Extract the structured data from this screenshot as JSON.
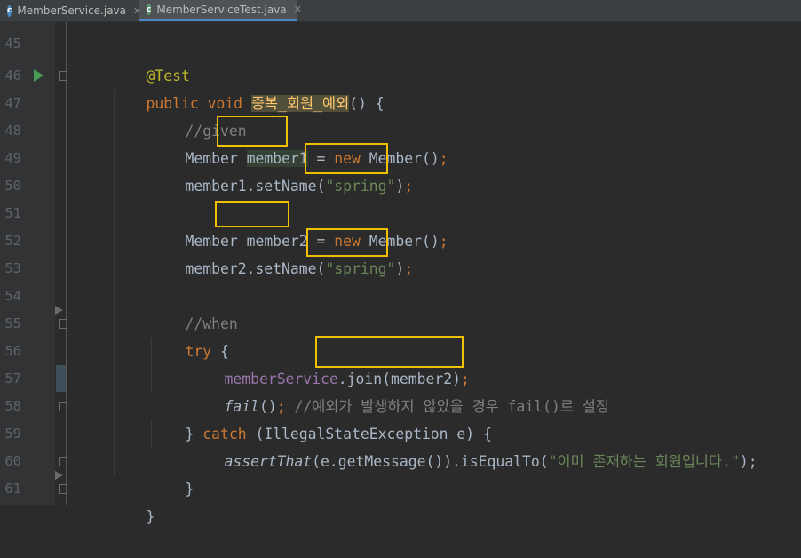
{
  "tabs": [
    {
      "label": "MemberService.java",
      "icon": "class-icon",
      "close": "✕"
    },
    {
      "label": "MemberServiceTest.java",
      "icon": "test-class-icon",
      "close": "✕"
    }
  ],
  "line_numbers": [
    "45",
    "46",
    "47",
    "48",
    "49",
    "50",
    "51",
    "52",
    "53",
    "54",
    "55",
    "56",
    "57",
    "58",
    "59",
    "60",
    "61"
  ],
  "code": {
    "l45": {
      "annotation": "@Test"
    },
    "l46": {
      "kw1": "public",
      "kw2": "void",
      "method": "중복_회원_예외",
      "rest": "() {"
    },
    "l47": {
      "comment": "//given"
    },
    "l48": {
      "type": "Member",
      "var": "member1",
      "eq": " = ",
      "kw": "new",
      "ctor": " Member()",
      "semi": ";"
    },
    "l49": {
      "call": "member1.setName(",
      "str": "\"spring\"",
      "close": ")",
      "semi": ";"
    },
    "l51": {
      "type": "Member",
      "var": "member2",
      "eq": " = ",
      "kw": "new",
      "ctor": " Member()",
      "semi": ";"
    },
    "l52": {
      "call": "member2.setName(",
      "str": "\"spring\"",
      "close": ")",
      "semi": ";"
    },
    "l54": {
      "comment": "//when"
    },
    "l55": {
      "kw": "try",
      "rest": " {"
    },
    "l56": {
      "field": "memberService",
      "call": ".join(member2)",
      "semi": ";"
    },
    "l57": {
      "fn": "fail",
      "paren": "()",
      "semi": ";",
      "comment": " //예외가 발생하지 않았을 경우 fail()로 설정"
    },
    "l58": {
      "brace": "} ",
      "kw": "catch",
      "rest": " (IllegalStateException e) {"
    },
    "l59": {
      "fn": "assertThat",
      "mid": "(e.getMessage()).isEqualTo(",
      "str": "\"이미 존재하는 회원입니다.\"",
      "end": ");"
    },
    "l60": {
      "brace": "}"
    },
    "l61": {
      "brace": "}"
    }
  },
  "colors": {
    "keyword": "#cc7832",
    "string": "#6a8759",
    "comment": "#808080",
    "annotation": "#bbb529",
    "field": "#9876aa",
    "highlight_box": "#f0c000"
  }
}
